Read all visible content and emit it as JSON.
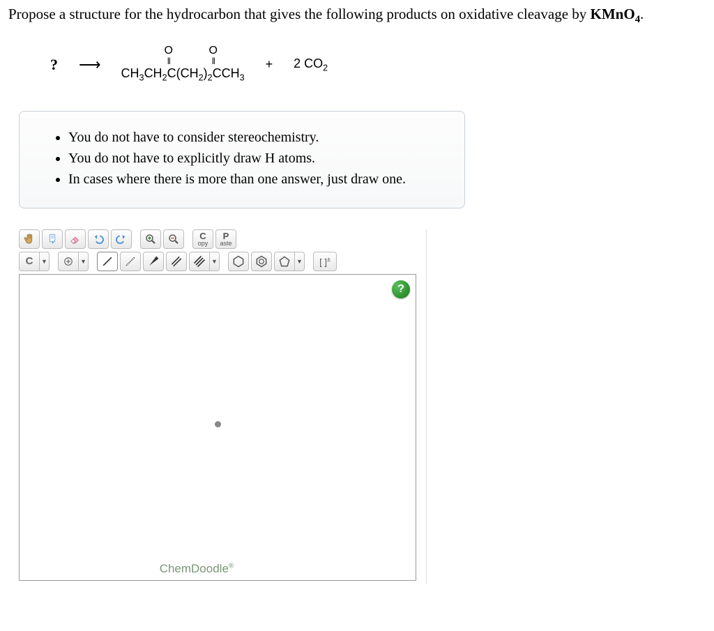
{
  "question": {
    "prefix": "Propose a structure for the hydrocarbon that gives the following products on oxidative cleavage by ",
    "reagent": "KMnO",
    "reagent_sub": "4",
    "suffix": "."
  },
  "reaction": {
    "unknown": "?",
    "arrow": "⟶",
    "product_main_display": "CH3CH2C(CH2)2CCH3",
    "plus": "+",
    "co2_coef": "2 CO",
    "co2_sub": "2"
  },
  "hints": [
    "You do not have to consider stereochemistry.",
    "You do not have to explicitly draw H atoms.",
    "In cases where there is more than one answer, just draw one."
  ],
  "toolbar": {
    "copy_big": "C",
    "copy_small": "opy",
    "paste_big": "P",
    "paste_small": "aste",
    "element": "C",
    "charge": "[ ]",
    "charge_sup": "±"
  },
  "help": "?",
  "brand": "ChemDoodle",
  "brand_reg": "®"
}
